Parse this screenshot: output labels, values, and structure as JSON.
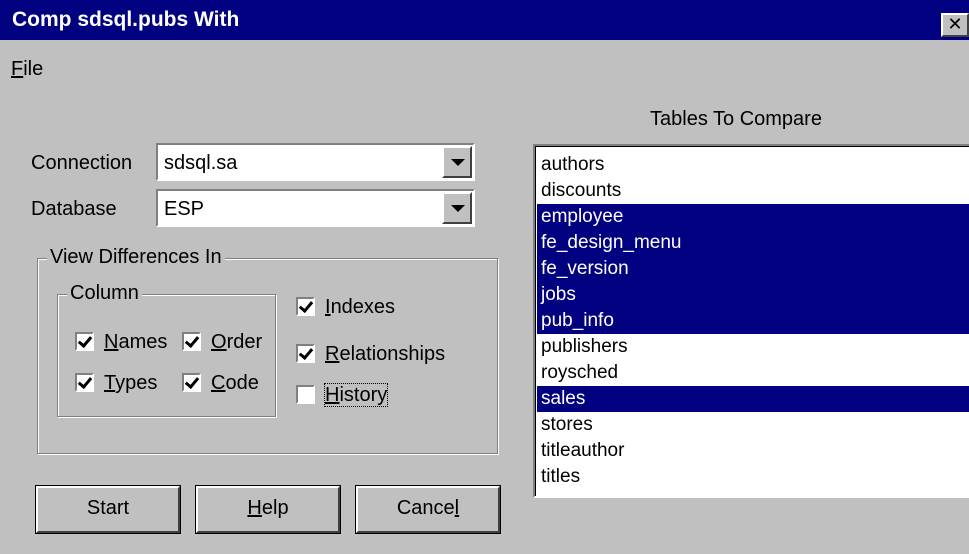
{
  "window": {
    "title": "Comp sdsql.pubs With",
    "close_glyph": "✕"
  },
  "menu": {
    "file_label_u": "F",
    "file_label_rest": "ile"
  },
  "form": {
    "connection_label": "Connection",
    "connection_value": "sdsql.sa",
    "database_label": "Database",
    "database_value": "ESP"
  },
  "view_differences": {
    "title": "View Differences In",
    "column_group_title": "Column",
    "names": {
      "u": "N",
      "rest": "ames",
      "checked": true
    },
    "order": {
      "u": "O",
      "rest": "rder",
      "checked": true
    },
    "types": {
      "u": "T",
      "rest": "ypes",
      "checked": true
    },
    "code": {
      "u": "C",
      "rest": "ode",
      "checked": true
    },
    "indexes": {
      "u": "I",
      "rest": "ndexes",
      "checked": true
    },
    "relationships": {
      "u": "R",
      "rest": "elationships",
      "checked": true
    },
    "history": {
      "u": "H",
      "rest": "istory",
      "checked": false
    }
  },
  "buttons": {
    "start": "Start",
    "help_u": "H",
    "help_rest": "elp",
    "cancel_pre": "Cance",
    "cancel_u": "l"
  },
  "tables": {
    "title": "Tables To Compare",
    "items": [
      {
        "name": "authors",
        "selected": false
      },
      {
        "name": "discounts",
        "selected": false
      },
      {
        "name": "employee",
        "selected": true
      },
      {
        "name": "fe_design_menu",
        "selected": true
      },
      {
        "name": "fe_version",
        "selected": true
      },
      {
        "name": "jobs",
        "selected": true
      },
      {
        "name": "pub_info",
        "selected": true
      },
      {
        "name": "publishers",
        "selected": false
      },
      {
        "name": "roysched",
        "selected": false
      },
      {
        "name": "sales",
        "selected": true
      },
      {
        "name": "stores",
        "selected": false
      },
      {
        "name": "titleauthor",
        "selected": false
      },
      {
        "name": "titles",
        "selected": false
      }
    ]
  },
  "colors": {
    "titlebar": "#000080",
    "face": "#c0c0c0",
    "selection": "#000080"
  }
}
